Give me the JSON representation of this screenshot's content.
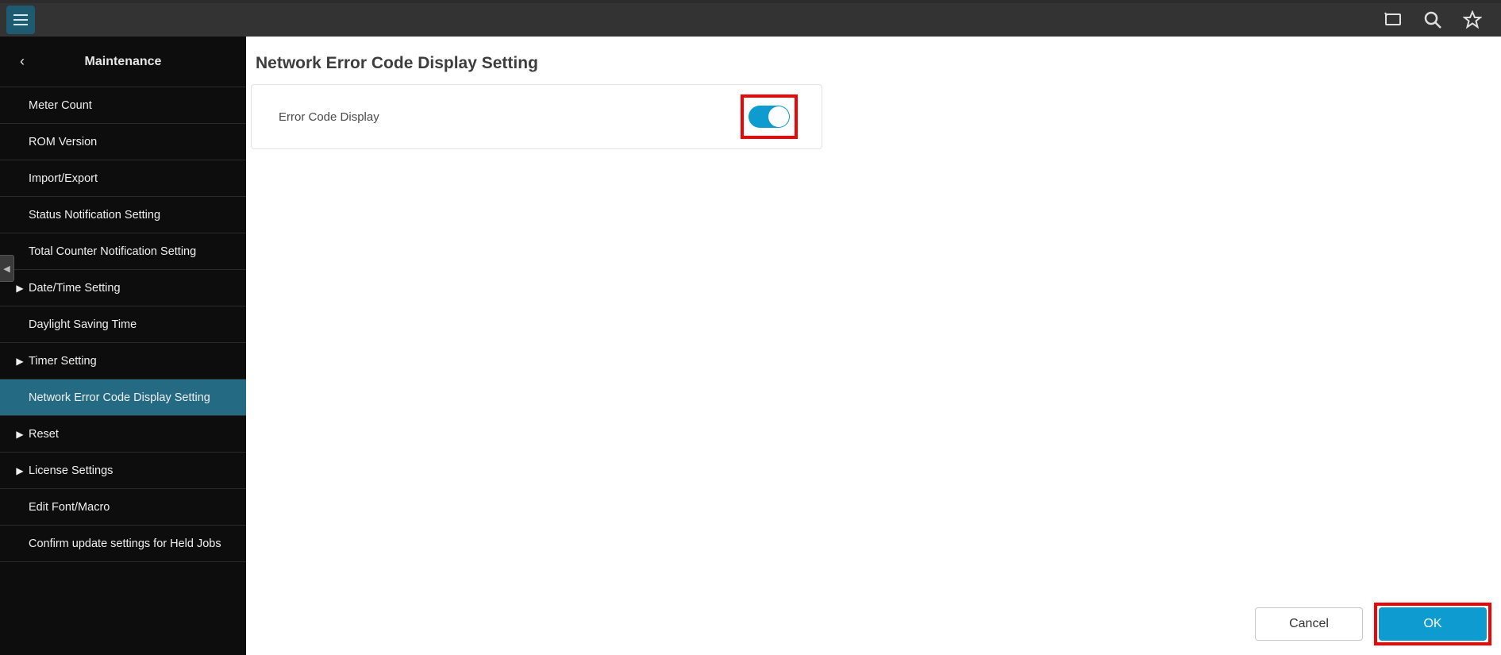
{
  "header": {},
  "sidebar": {
    "title": "Maintenance",
    "items": [
      {
        "label": "Meter Count",
        "expandable": false,
        "active": false
      },
      {
        "label": "ROM Version",
        "expandable": false,
        "active": false
      },
      {
        "label": "Import/Export",
        "expandable": false,
        "active": false
      },
      {
        "label": "Status Notification Setting",
        "expandable": false,
        "active": false
      },
      {
        "label": "Total Counter Notification Setting",
        "expandable": false,
        "active": false
      },
      {
        "label": "Date/Time Setting",
        "expandable": true,
        "active": false
      },
      {
        "label": "Daylight Saving Time",
        "expandable": false,
        "active": false
      },
      {
        "label": "Timer Setting",
        "expandable": true,
        "active": false
      },
      {
        "label": "Network Error Code Display Setting",
        "expandable": false,
        "active": true
      },
      {
        "label": "Reset",
        "expandable": true,
        "active": false
      },
      {
        "label": "License Settings",
        "expandable": true,
        "active": false
      },
      {
        "label": "Edit Font/Macro",
        "expandable": false,
        "active": false
      },
      {
        "label": "Confirm update settings for Held Jobs",
        "expandable": false,
        "active": false
      }
    ]
  },
  "page": {
    "title": "Network Error Code Display Setting",
    "setting_label": "Error Code Display",
    "toggle_on": true
  },
  "footer": {
    "cancel": "Cancel",
    "ok": "OK"
  }
}
